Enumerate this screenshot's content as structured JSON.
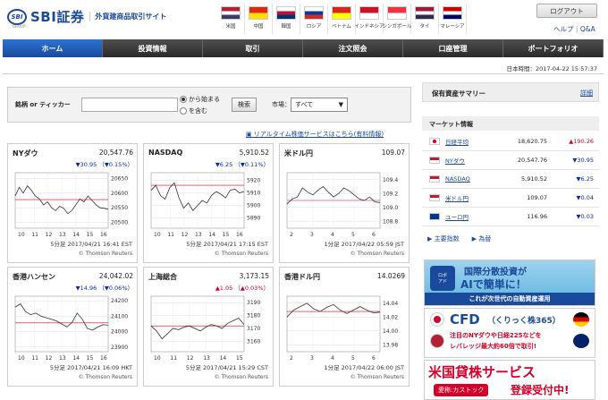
{
  "header": {
    "logo_mark": "SBI",
    "logo_text": "SBI証券",
    "logo_sub": "外貨建商品取引サイト",
    "logo_group": "GROUP",
    "login": "ログアウト",
    "help": "ヘルプ",
    "qa": "Q&A",
    "flags": [
      {
        "name": "米国",
        "icon": "us-flag-icon",
        "colors": [
          "#b22234",
          "#ffffff",
          "#3c3b6e"
        ]
      },
      {
        "name": "中国",
        "icon": "cn-flag-icon",
        "colors": [
          "#de2910",
          "#ffde00"
        ]
      },
      {
        "name": "韓国",
        "icon": "kr-flag-icon",
        "colors": [
          "#ffffff",
          "#c60c30",
          "#003478"
        ]
      },
      {
        "name": "ロシア",
        "icon": "ru-flag-icon",
        "colors": [
          "#ffffff",
          "#0039a6",
          "#d52b1e"
        ]
      },
      {
        "name": "ベトナム",
        "icon": "vn-flag-icon",
        "colors": [
          "#da251d",
          "#ffff00"
        ]
      },
      {
        "name": "インドネシア",
        "icon": "id-flag-icon",
        "colors": [
          "#ce1126",
          "#ffffff"
        ]
      },
      {
        "name": "シンガポール",
        "icon": "sg-flag-icon",
        "colors": [
          "#ef3340",
          "#ffffff"
        ]
      },
      {
        "name": "タイ",
        "icon": "th-flag-icon",
        "colors": [
          "#a51931",
          "#f4f5f8",
          "#2d2a4a"
        ]
      },
      {
        "name": "マレーシア",
        "icon": "my-flag-icon",
        "colors": [
          "#cc0001",
          "#ffffff",
          "#010066"
        ]
      }
    ]
  },
  "nav": [
    "ホーム",
    "投資情報",
    "取引",
    "注文照会",
    "口座管理",
    "ポートフォリオ"
  ],
  "datetime": "日本時間：2017-04-22 15:57:37",
  "search": {
    "label": "銘柄 or ティッカー",
    "radio1": "から始まる",
    "radio2": "を含む",
    "button": "検索",
    "market_label": "市場：",
    "market_value": "すべて"
  },
  "realtime_link": "リアルタイム株価サービスはこちら(有料情報)",
  "cards": [
    {
      "title": "NYダウ",
      "value": "20,547.76",
      "change": "▼30.95 （▼0.15%）",
      "dir": "down",
      "time": "5分足 2017/04/21 16:41 EST",
      "src": "© Thomson Reuters",
      "chart_data": {
        "type": "line",
        "yticks": [
          "20650",
          "20600",
          "20550",
          "20500"
        ],
        "xticks": [
          "10",
          "11",
          "12",
          "13",
          "14",
          "15",
          "16"
        ],
        "ylim": [
          20480,
          20670
        ],
        "values": [
          20590,
          20620,
          20600,
          20625,
          20610,
          20590,
          20580,
          20560,
          20570,
          20550,
          20540,
          20555,
          20548,
          20530,
          20540,
          20560,
          20580,
          20570,
          20590,
          20575,
          20560,
          20550,
          20548,
          20545
        ],
        "ref": 20578
      }
    },
    {
      "title": "NASDAQ",
      "value": "5,910.52",
      "change": "▼6.25 （▼0.11%）",
      "dir": "down",
      "time": "5分足 2017/04/21 17:15 EST",
      "src": "© Thomson Reuters",
      "chart_data": {
        "type": "line",
        "yticks": [
          "5920",
          "5910",
          "5900",
          "5890"
        ],
        "xticks": [
          "10",
          "11",
          "12",
          "13",
          "14",
          "15",
          "16"
        ],
        "ylim": [
          5882,
          5926
        ],
        "values": [
          5912,
          5916,
          5908,
          5905,
          5914,
          5918,
          5906,
          5898,
          5902,
          5896,
          5900,
          5904,
          5902,
          5908,
          5911,
          5909,
          5906,
          5912,
          5913,
          5910,
          5911
        ],
        "ref": 5916
      }
    },
    {
      "title": "米ドル円",
      "value": "109.07",
      "change": "",
      "dir": "down",
      "time": "1分足 2017/04/22 05:59 JST",
      "src": "© Thomson Reuters",
      "chart_data": {
        "type": "line",
        "yticks": [
          "109.4",
          "109.2",
          "109.0",
          "108.8"
        ],
        "xticks": [
          "2",
          "3",
          "4",
          "5",
          "6"
        ],
        "ylim": [
          108.7,
          109.5
        ],
        "values": [
          109.05,
          109.12,
          109.15,
          109.28,
          109.22,
          109.18,
          109.25,
          109.3,
          109.22,
          109.15,
          109.2,
          109.28,
          109.24,
          109.18,
          109.12,
          109.1,
          109.15,
          109.08,
          109.07
        ],
        "ref": 109.1
      }
    },
    {
      "title": "香港ハンセン",
      "value": "24,042.02",
      "change": "▼14.96 （▼0.06%）",
      "dir": "down",
      "time": "5分足 2017/04/21 16:09 HKT",
      "src": "© Thomson Reuters",
      "chart_data": {
        "type": "line",
        "yticks": [
          "24200",
          "24100",
          "24000",
          "23900"
        ],
        "xticks": [
          "10",
          "11",
          "12",
          "13",
          "14",
          "15",
          "16"
        ],
        "ylim": [
          23870,
          24230
        ],
        "values": [
          24160,
          24180,
          24130,
          24110,
          24120,
          24100,
          24090,
          24080,
          24070,
          24050,
          24030,
          24060,
          24120,
          24080,
          24020,
          24010,
          24030,
          24045,
          24042
        ],
        "ref": 24057
      }
    },
    {
      "title": "上海総合",
      "value": "3,173.15",
      "change": "▲1.05 （▲0.03%）",
      "dir": "up",
      "time": "5分足 2017/04/21 15:29 CST",
      "src": "© Thomson Reuters",
      "chart_data": {
        "type": "line",
        "yticks": [
          "3190",
          "3180",
          "3170",
          "3160"
        ],
        "xticks": [
          "10",
          "11",
          "12",
          "13",
          "14",
          "15"
        ],
        "ylim": [
          3152,
          3195
        ],
        "values": [
          3172,
          3168,
          3162,
          3166,
          3170,
          3169,
          3171,
          3172,
          3170,
          3168,
          3171,
          3173,
          3172,
          3170,
          3174,
          3176,
          3178,
          3173
        ],
        "ref": 3172
      }
    },
    {
      "title": "香港ドル円",
      "value": "14.0269",
      "change": "",
      "dir": "down",
      "time": "1分足 2017/04/22 06:00 JST",
      "src": "© Thomson Reuters",
      "chart_data": {
        "type": "line",
        "yticks": [
          "14.04",
          "14.02",
          "14.00",
          "13.98"
        ],
        "xticks": [
          "2",
          "3",
          "4",
          "5",
          "6"
        ],
        "ylim": [
          13.97,
          14.05
        ],
        "values": [
          14.02,
          14.03,
          14.035,
          14.04,
          14.032,
          14.028,
          14.034,
          14.038,
          14.03,
          14.025,
          14.03,
          14.035,
          14.03,
          14.026,
          14.027
        ],
        "ref": 14.028
      }
    }
  ],
  "side": {
    "holdings_title": "保有資産サマリー",
    "detail": "詳細",
    "market_title": "マーケット情報",
    "markets": [
      {
        "name": "日経平均",
        "value": "18,620.75",
        "change": "▲190.26",
        "dir": "up",
        "icon": "jp-flag-icon"
      },
      {
        "name": "NYダウ",
        "value": "20,547.76",
        "change": "▼30.95",
        "dir": "down",
        "icon": "us-flag-icon"
      },
      {
        "name": "NASDAQ",
        "value": "5,910.52",
        "change": "▼6.25",
        "dir": "down",
        "icon": "us-flag-icon"
      },
      {
        "name": "米ドル円",
        "value": "109.07",
        "change": "▼0.04",
        "dir": "down",
        "icon": "us-flag-icon"
      },
      {
        "name": "ユーロ円",
        "value": "116.96",
        "change": "▼0.03",
        "dir": "down",
        "icon": "eu-flag-icon"
      }
    ],
    "link1": "主要指数",
    "link2": "為替",
    "banner1_line1": "国際分散投資が",
    "banner1_line2": "AIで簡単に！",
    "banner1_line3": "これが次世代の自動資産運用",
    "banner2_title": "CFD",
    "banner2_sub": "（くりっく株365）",
    "banner2_line1": "注目のNYダウや日経225などを",
    "banner2_line2": "レバレッジ最大約60倍で取引!",
    "banner3_title": "米国貸株サービス",
    "banner3_sub1": "愛称:カストック",
    "banner3_sub2": "登録受付中!"
  },
  "colors": {
    "brand": "#1a4a9c",
    "nav_active": "#2d72d2",
    "up": "#d4002a",
    "down": "#0a2ba8"
  }
}
